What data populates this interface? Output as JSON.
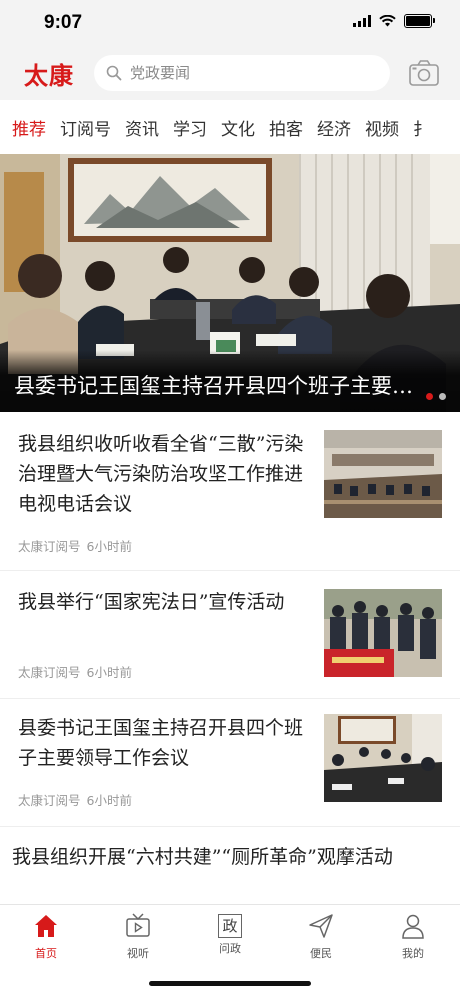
{
  "status": {
    "time": "9:07"
  },
  "header": {
    "logo": "太康",
    "search_placeholder": "党政要闻"
  },
  "tabs": [
    {
      "label": "推荐",
      "active": true
    },
    {
      "label": "订阅号"
    },
    {
      "label": "资讯"
    },
    {
      "label": "学习"
    },
    {
      "label": "文化"
    },
    {
      "label": "拍客"
    },
    {
      "label": "经济"
    },
    {
      "label": "视频"
    },
    {
      "label": "扌"
    }
  ],
  "banner": {
    "title": "县委书记王国玺主持召开县四个班子主要…"
  },
  "news": [
    {
      "title": "我县组织收听收看全省“三散”污染治理暨大气污染防治攻坚工作推进电视电话会议",
      "source": "太康订阅号",
      "time": "6小时前"
    },
    {
      "title": "我县举行“国家宪法日”宣传活动",
      "source": "太康订阅号",
      "time": "6小时前"
    },
    {
      "title": "县委书记王国玺主持召开县四个班子主要领导工作会议",
      "source": "太康订阅号",
      "time": "6小时前"
    },
    {
      "title": "我县组织开展“六村共建”“厕所革命”观摩活动"
    }
  ],
  "bottom_nav": [
    {
      "label": "首页",
      "icon": "home-icon",
      "active": true
    },
    {
      "label": "视听",
      "icon": "tv-icon"
    },
    {
      "label": "问政",
      "icon": "zheng-icon",
      "glyph": "政"
    },
    {
      "label": "便民",
      "icon": "send-icon"
    },
    {
      "label": "我的",
      "icon": "user-icon"
    }
  ],
  "colors": {
    "accent": "#d71a1a",
    "header_bg": "#f3f3f3"
  }
}
